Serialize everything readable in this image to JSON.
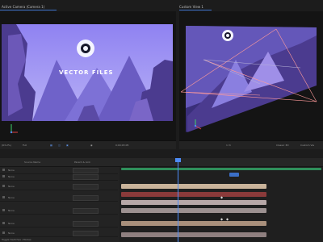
{
  "viewers": {
    "left": {
      "title": "Active Camera (Camera 1)",
      "overlay_text": "VECTOR FILES",
      "toolbar": [
        "(63.2%)",
        "Full",
        "0;00;03;05"
      ]
    },
    "right": {
      "title": "Custom View 1",
      "toolbar": [
        "1 Vi",
        "Classic 3D",
        "Custom Vie"
      ]
    }
  },
  "timeline": {
    "header": {
      "source_col": "Source Name",
      "parent_col": "Parent & Link"
    },
    "layers": [
      {
        "label": "None"
      },
      {
        "label": "None"
      },
      {
        "label": "None"
      },
      {
        "label": "None"
      },
      {
        "label": "None"
      },
      {
        "label": "None"
      },
      {
        "label": "None"
      }
    ],
    "track_colors": [
      "#2f8f5b",
      "#7a4949",
      "#c9b39a",
      "#8a3a3a",
      "#b7a8a8",
      "#9c9191",
      "#a9907c",
      "#5a4f7a"
    ],
    "footer_value": "Toggle Switches / Modes"
  },
  "colors": {
    "accent": "#4e8cf5",
    "sky": "#8d7ff0",
    "cliff": "#5e4aa8",
    "moon": "#ffffff"
  }
}
